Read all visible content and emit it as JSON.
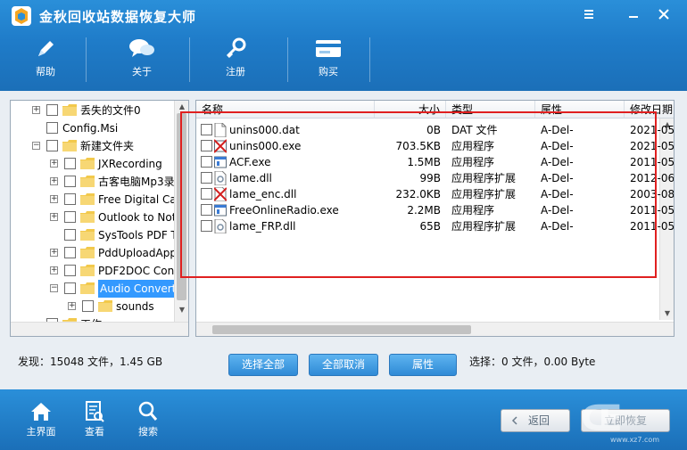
{
  "app": {
    "title": "金秋回收站数据恢复大师"
  },
  "toolbar": {
    "help": "帮助",
    "about": "关于",
    "register": "注册",
    "buy": "购买"
  },
  "tree": {
    "items": [
      {
        "label": "丢失的文件0",
        "expander": "+"
      },
      {
        "label": "Config.Msi",
        "expander": ""
      },
      {
        "label": "新建文件夹",
        "expander": "−"
      },
      {
        "label": "JXRecording",
        "expander": "+"
      },
      {
        "label": "古客电脑Mp3录",
        "expander": "+"
      },
      {
        "label": "Free Digital Car",
        "expander": "+"
      },
      {
        "label": "Outlook to Not",
        "expander": "+"
      },
      {
        "label": "SysTools PDF T",
        "expander": ""
      },
      {
        "label": "PddUploadApp",
        "expander": "+"
      },
      {
        "label": "PDF2DOC Conv",
        "expander": "+"
      },
      {
        "label": "Audio Convert",
        "expander": "−",
        "selected": true
      },
      {
        "label": "sounds",
        "expander": "+"
      },
      {
        "label": "工作",
        "expander": ""
      }
    ]
  },
  "list": {
    "columns": {
      "name": "名称",
      "size": "大小",
      "type": "类型",
      "attr": "属性",
      "mtime": "修改日期"
    },
    "files": [
      {
        "name": "unins000.dat",
        "size": "0B",
        "type": "DAT 文件",
        "attr": "A-Del-",
        "mtime": "2021-05-",
        "icon": "file-icon"
      },
      {
        "name": "unins000.exe",
        "size": "703.5KB",
        "type": "应用程序",
        "attr": "A-Del-",
        "mtime": "2021-05-",
        "icon": "broken-exe-icon"
      },
      {
        "name": "ACF.exe",
        "size": "1.5MB",
        "type": "应用程序",
        "attr": "A-Del-",
        "mtime": "2011-05-",
        "icon": "exe-icon"
      },
      {
        "name": "lame.dll",
        "size": "99B",
        "type": "应用程序扩展",
        "attr": "A-Del-",
        "mtime": "2012-06-",
        "icon": "dll-icon"
      },
      {
        "name": "lame_enc.dll",
        "size": "232.0KB",
        "type": "应用程序扩展",
        "attr": "A-Del-",
        "mtime": "2003-08-",
        "icon": "broken-dll-icon"
      },
      {
        "name": "FreeOnlineRadio.exe",
        "size": "2.2MB",
        "type": "应用程序",
        "attr": "A-Del-",
        "mtime": "2011-05-",
        "icon": "exe-icon"
      },
      {
        "name": "lame_FRP.dll",
        "size": "65B",
        "type": "应用程序扩展",
        "attr": "A-Del-",
        "mtime": "2011-05-",
        "icon": "dll-icon"
      }
    ]
  },
  "status": {
    "found": "发现：15048 文件，1.45 GB",
    "selected": "选择：0 文件，0.00 Byte"
  },
  "actions": {
    "select_all": "选择全部",
    "deselect_all": "全部取消",
    "properties": "属性"
  },
  "bottom": {
    "home": "主界面",
    "view": "查看",
    "search": "搜索",
    "back": "返回",
    "recover": "立即恢复"
  },
  "watermark": {
    "logo": "Œ",
    "site": "www.xz7.com"
  },
  "colors": {
    "accent": "#1f7cc9",
    "selection": "#3399ff",
    "highlight_box": "#e02020",
    "folder": "#f2c94c"
  }
}
